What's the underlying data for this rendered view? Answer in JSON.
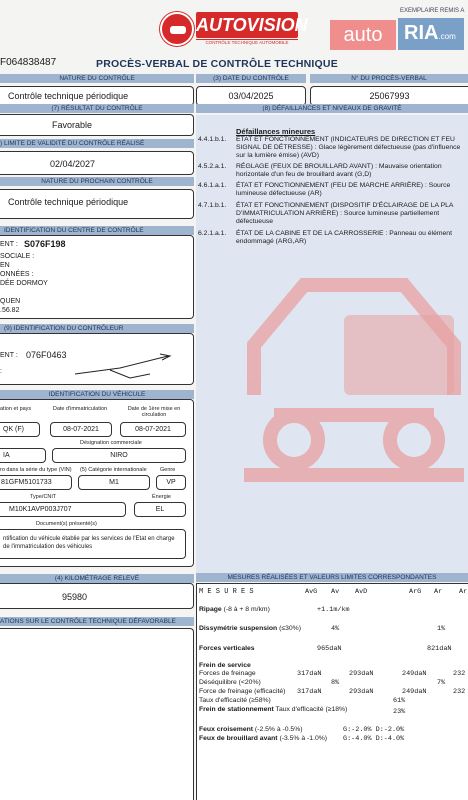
{
  "header": {
    "doc_number": "F064838487",
    "logo_text": "AUTOVISION",
    "logo_sub": "CONTRÔLE TECHNIQUE AUTOMOBILE",
    "title": "PROCÈS-VERBAL DE CONTRÔLE TECHNIQUE",
    "watermark_auto": "auto",
    "watermark_ria": "RIA",
    "watermark_com": ".com",
    "top_right_note": "EXEMPLAIRE REMIS A"
  },
  "sections": {
    "nature": {
      "label": "NATURE DU CONTRÔLE",
      "value": "Contrôle technique périodique"
    },
    "date": {
      "label": "(3) DATE DU CONTRÔLE",
      "value": "03/04/2025"
    },
    "pv_number": {
      "label": "N° DU PROCÈS-VERBAL",
      "value": "25067993"
    },
    "result": {
      "label": "(7) RÉSULTAT DU CONTRÔLE",
      "value": "Favorable"
    },
    "defects_header": "(8) DÉFAILLANCES ET NIVEAUX DE GRAVITÉ",
    "validity": {
      "label": ") LIMITE DE VALIDITÉ DU CONTRÔLE RÉALISÉ",
      "value": "02/04/2027"
    },
    "next_nature": {
      "label": "NATURE DU PROCHAIN CONTRÔLE",
      "value": "Contrôle technique périodique"
    },
    "center": {
      "label": "IDENTIFICATION DU CENTRE DE CONTRÔLE",
      "lines": [
        "ENT :",
        "S076F198",
        "SOCIALE :",
        "EN",
        "ONNÉES :",
        "DÉE DORMOY",
        "",
        "QUEN",
        ".56.82"
      ]
    },
    "controller": {
      "label": "(9) IDENTIFICATION DU CONTRÔLEUR",
      "agreement_label": "ENT :",
      "agreement_value": "076F0463",
      "sig_label": ":"
    },
    "vehicle": {
      "label": "IDENTIFICATION DU VÉHICULE",
      "col_labels": [
        "ation et pays",
        "Date d'immatriculation",
        "Date de 1ère mise en circulation"
      ],
      "row1": [
        "QK (F)",
        "08-07-2021",
        "08-07-2021"
      ],
      "commercial_label": "Désignation commerciale",
      "row2": [
        "IA",
        "NIRO"
      ],
      "vin_label": "ro dans la série du type (VIN)",
      "intl_label": "(5) Catégorie internationale",
      "genre_label": "Genre",
      "row3": [
        "81GFM5101733",
        "M1",
        "VP"
      ],
      "cnit_label": "Type/CNIT",
      "energy_label": "Énergie",
      "row4": [
        "M10K1AVP003J707",
        "EL"
      ],
      "docs_label": "Document(s) présenté(s)",
      "docs_text": "ntification du véhicule établie par les services de l'Etat en charge de l'immatriculation des véhicules"
    },
    "mileage": {
      "label": "(4) KILOMÉTRAGE RELEVÉ",
      "value": "95980"
    },
    "unfavorable": {
      "label": "ATIONS SUR LE CONTRÔLE TECHNIQUE DÉFAVORABLE"
    },
    "measures_header": "MESURES RÉALISÉES ET VALEURS LIMITES CORRESPONDANTES"
  },
  "defects": {
    "title": "Défaillances mineures",
    "items": [
      {
        "code": "4.4.1.b.1.",
        "text": "ÉTAT ET FONCTIONNEMENT (INDICATEURS DE DIRECTION ET FEU SIGNAL DE DÉTRESSE) : Glace légèrement défectueuse (pas d'influence sur la lumière émise) (AVD)"
      },
      {
        "code": "4.5.2.a.1.",
        "text": "RÉGLAGE (FEUX DE BROUILLARD AVANT) : Mauvaise orientation horizontale d'un feu de brouillard avant (G,D)"
      },
      {
        "code": "4.6.1.a.1.",
        "text": "ÉTAT ET FONCTIONNEMENT (FEU DE MARCHE ARRIÈRE) : Source lumineuse défectueuse (AR)"
      },
      {
        "code": "4.7.1.b.1.",
        "text": "ÉTAT ET FONCTIONNEMENT (DISPOSITIF D'ÉCLAIRAGE DE LA PLA D'IMMATRICULATION ARRIÈRE) : Source lumineuse partiellement défectueuse"
      },
      {
        "code": "6.2.1.a.1.",
        "text": "ÉTAT DE LA CABINE ET DE LA CARROSSERIE : Panneau ou élément endommagé (ARG,AR)"
      }
    ]
  },
  "measures": {
    "col_header": "M E S U R E S",
    "cols": [
      "AvG",
      "Av",
      "AvD",
      "ArG",
      "Ar",
      "Ar"
    ],
    "ripage_label": "Ripage",
    "ripage_limit": "(-8 à + 8 m/km)",
    "ripage_value": "+1.1m/km",
    "dissym_label": "Dissymétrie suspension",
    "dissym_limit": "(≤30%)",
    "dissym_av": "4%",
    "dissym_ar": "1%",
    "forces_label": "Forces verticales",
    "forces_av": "965daN",
    "forces_ar": "821daN",
    "brake_title": "Frein de service",
    "brake_forces_label": "Forces de freinage",
    "brake_forces": [
      "317daN",
      "293daN",
      "249daN",
      "232"
    ],
    "desequilibre_label": "Déséquilibre (<20%)",
    "desequilibre": [
      "8%",
      "7%"
    ],
    "eff_force_label": "Force de freinage (efficacité)",
    "eff_force": [
      "317daN",
      "293daN",
      "249daN",
      "232"
    ],
    "taux_label": "Taux d'efficacité",
    "taux_limit": "(≥58%)",
    "taux_value": "61%",
    "stationnement_label": "Frein de stationnement",
    "stationnement_taux": "Taux d'efficacité (≥18%)",
    "stationnement_value": "23%",
    "feux_croisement_label": "Feux croisement",
    "feux_croisement_limit": "(-2.5% à -0.5%)",
    "feux_croisement_values": "G:-2.0%   D:-2.0%",
    "feux_brouillard_label": "Feux de brouillard avant",
    "feux_brouillard_limit": "(-3.5% à -1.0%)",
    "feux_brouillard_values": "G:-4.0%   D:-4.0%"
  }
}
